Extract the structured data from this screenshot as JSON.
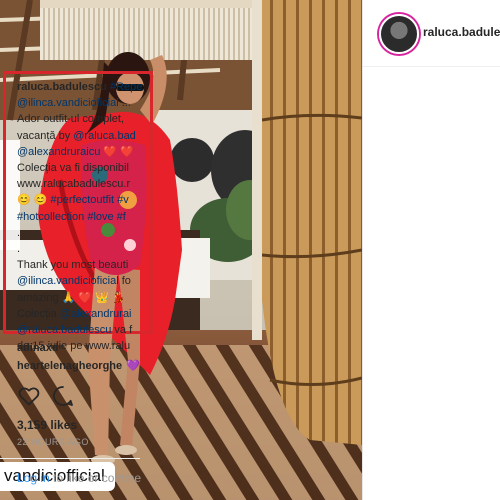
{
  "post": {
    "username": "raluca.badulescu",
    "photo_tag": "vandiciofficial"
  },
  "caption": {
    "lines": [
      [
        {
          "t": "u",
          "v": "raluca.badulescu"
        },
        {
          "t": "s",
          "v": " "
        },
        {
          "t": "l",
          "v": "#Repe"
        }
      ],
      [
        {
          "t": "l",
          "v": "@ilinca.vandicioficial"
        },
        {
          "t": "s",
          "v": " ..."
        }
      ],
      [
        {
          "t": "s",
          "v": "Ador outfit-ul complet,"
        }
      ],
      [
        {
          "t": "s",
          "v": "vacanță by "
        },
        {
          "t": "l",
          "v": "@raluca.bad"
        }
      ],
      [
        {
          "t": "l",
          "v": "@alexandruraicu"
        },
        {
          "t": "s",
          "v": " ❤️ ❤️"
        }
      ],
      [
        {
          "t": "s",
          "v": "Colecția va fi disponibil"
        }
      ],
      [
        {
          "t": "s",
          "v": "www.ralucabadulescu.r"
        }
      ],
      [
        {
          "t": "s",
          "v": "😊 😊 "
        },
        {
          "t": "l",
          "v": "#perfectoutfit #v"
        }
      ],
      [
        {
          "t": "l",
          "v": "#hotcollection #love #f"
        }
      ],
      [
        {
          "t": "s",
          "v": "."
        }
      ],
      [
        {
          "t": "s",
          "v": "."
        }
      ],
      [
        {
          "t": "s",
          "v": "Thank you most beauti"
        }
      ],
      [
        {
          "t": "l",
          "v": "@ilinca.vandicioficial"
        },
        {
          "t": "s",
          "v": " fo"
        }
      ],
      [
        {
          "t": "s",
          "v": "amazing 🙏 ❤️ 👑 💃 "
        }
      ],
      [
        {
          "t": "s",
          "v": "Colecția "
        },
        {
          "t": "l",
          "v": "@alexandrurai"
        }
      ],
      [
        {
          "t": "l",
          "v": "@raluca.badulescu"
        },
        {
          "t": "s",
          "v": " va f"
        }
      ],
      [
        {
          "t": "s",
          "v": "de 15 iulie pe www.ralu"
        }
      ]
    ]
  },
  "comments": [
    {
      "user": "adinaxd",
      "text": ""
    },
    {
      "user": "heartelenagheorghe",
      "text": "💜"
    }
  ],
  "stats": {
    "likes": "3,159 likes",
    "time": "22 HOURS AGO"
  },
  "footer": {
    "login_link": "Log in",
    "login_rest": " to like or comme"
  },
  "colors": {
    "highlight_box": "#d8262d",
    "link": "#003569",
    "login": "#3897f0"
  },
  "icons": [
    "heart-icon",
    "comment-icon"
  ]
}
